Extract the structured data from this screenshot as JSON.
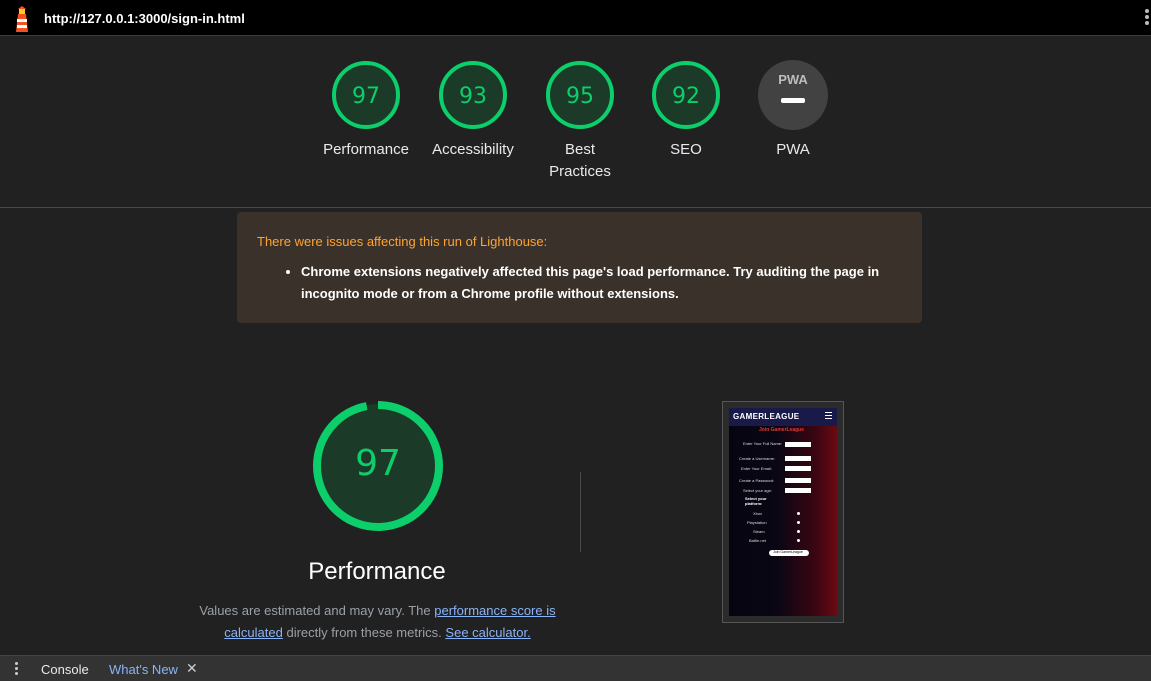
{
  "header": {
    "url": "http://127.0.0.1:3000/sign-in.html"
  },
  "scores": [
    {
      "value": "97",
      "label": "Performance"
    },
    {
      "value": "93",
      "label": "Accessibility"
    },
    {
      "value": "95",
      "label": "Best Practices"
    },
    {
      "value": "92",
      "label": "SEO"
    },
    {
      "value": "PWA",
      "label": "PWA"
    }
  ],
  "warning": {
    "title": "There were issues affecting this run of Lighthouse:",
    "item": "Chrome extensions negatively affected this page's load performance. Try auditing the page in incognito mode or from a Chrome profile without extensions."
  },
  "performance": {
    "score": "97",
    "title": "Performance",
    "desc_prefix": "Values are estimated and may vary. The",
    "link_score": "performance score is calculated",
    "desc_middle": "directly from these metrics.",
    "link_calc": "See calculator."
  },
  "thumbnail": {
    "brand": "GAMERLEAGUE",
    "heading": "Join GamerLeague",
    "fields": [
      "Enter Your Full Name:",
      "Create a Username:",
      "Enter Your Email:",
      "Create a Password:",
      "Select your age:"
    ],
    "platform_heading": "Select your platform:",
    "platforms": [
      "Xbox",
      "Playstation",
      "Steam",
      "Battle.net"
    ],
    "button": "Join GamerLeague"
  },
  "bottombar": {
    "menu": "Console",
    "tab": "What's New"
  },
  "colors": {
    "pass": "#0cce6b",
    "warn": "#ffa333"
  }
}
